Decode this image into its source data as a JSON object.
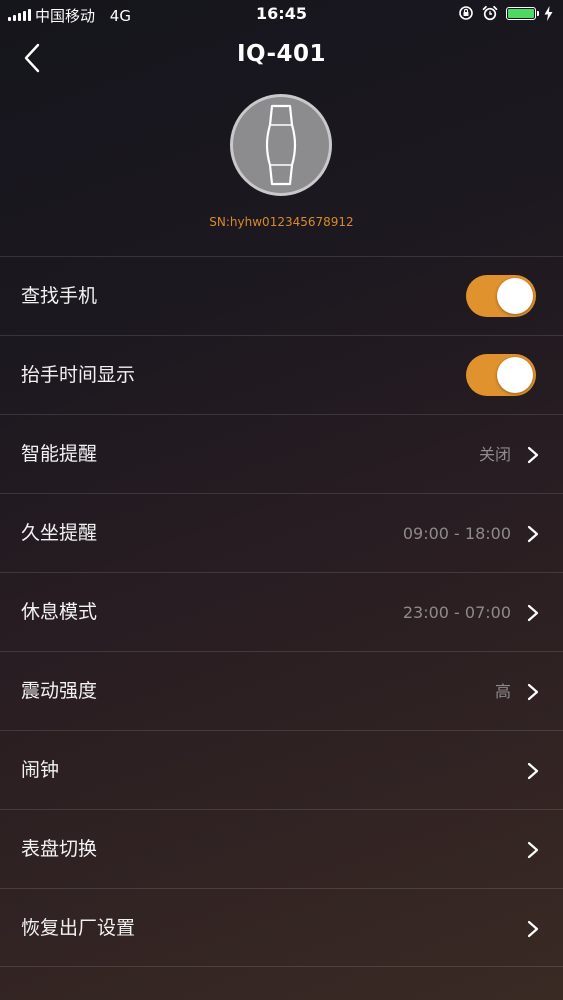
{
  "status_bar": {
    "carrier": "中国移动",
    "network": "4G",
    "time": "16:45",
    "battery_level": 1.0,
    "battery_color": "#4cd964",
    "icons": [
      "signal-icon",
      "orientation-lock-icon",
      "alarm-icon",
      "battery-icon",
      "charging-icon"
    ]
  },
  "header": {
    "title": "IQ-401",
    "back_icon": "chevron-left-icon"
  },
  "device": {
    "icon": "band-icon",
    "serial": "SN:hyhw012345678912"
  },
  "settings": [
    {
      "label": "查找手机",
      "type": "toggle",
      "on": true
    },
    {
      "label": "抬手时间显示",
      "type": "toggle",
      "on": true
    },
    {
      "label": "智能提醒",
      "type": "link",
      "value": "关闭"
    },
    {
      "label": "久坐提醒",
      "type": "link",
      "value": "09:00 - 18:00"
    },
    {
      "label": "休息模式",
      "type": "link",
      "value": "23:00 - 07:00"
    },
    {
      "label": "震动强度",
      "type": "link",
      "value": "高"
    },
    {
      "label": "闹钟",
      "type": "link",
      "value": ""
    },
    {
      "label": "表盘切换",
      "type": "link",
      "value": ""
    },
    {
      "label": "恢复出厂设置",
      "type": "link",
      "value": ""
    }
  ],
  "colors": {
    "accent": "#e0922e",
    "serial_text": "#d88a2a",
    "value_text": "#8d8b8c"
  }
}
